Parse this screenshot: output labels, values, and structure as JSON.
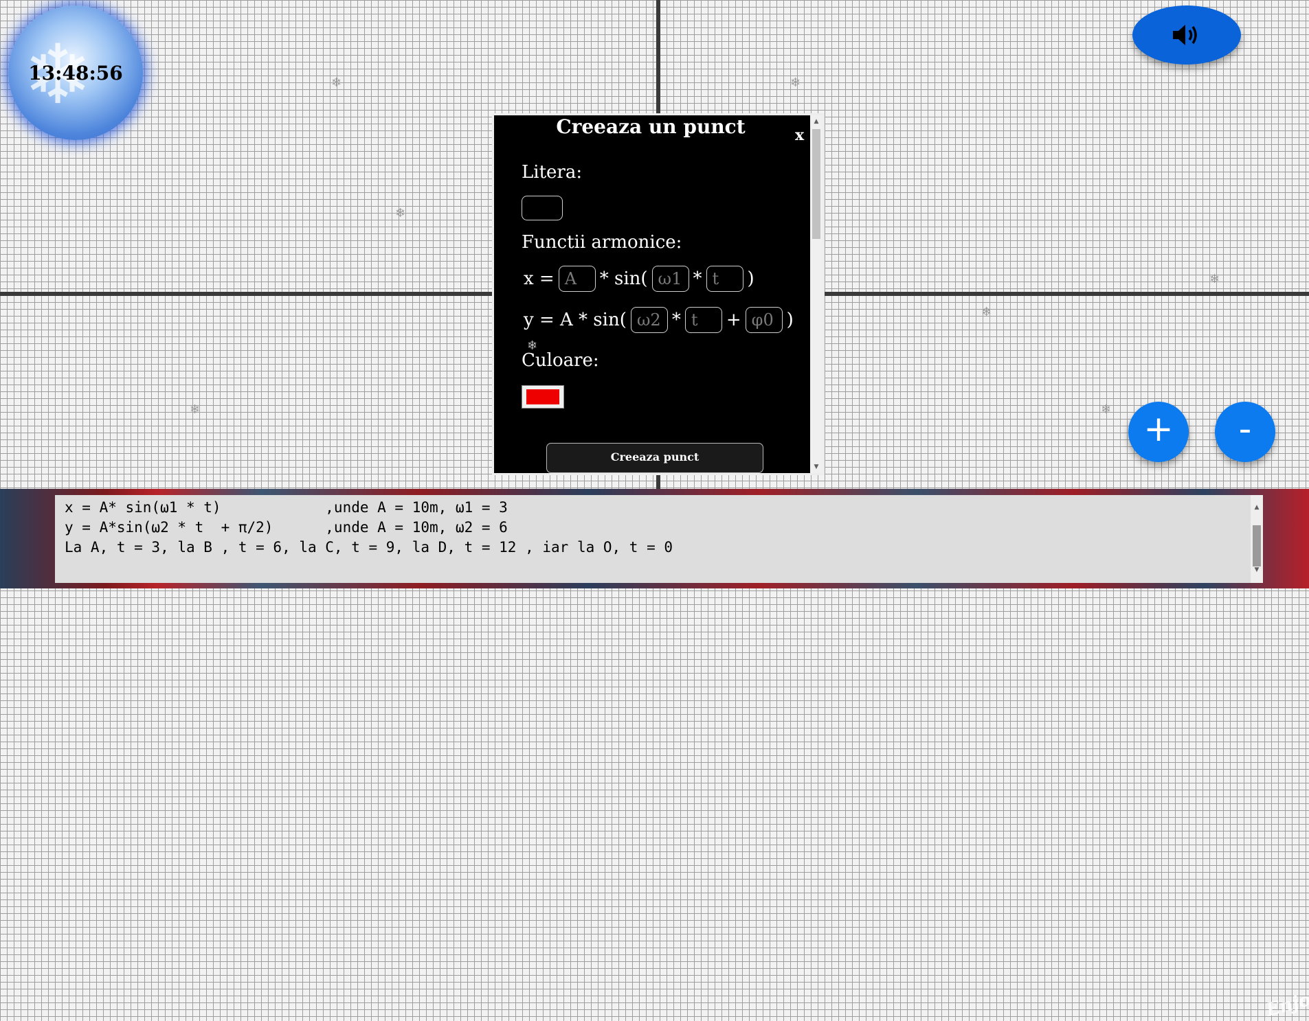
{
  "clock": {
    "time": "13:48:56"
  },
  "sound_button": {
    "icon": "speaker-icon"
  },
  "zoom": {
    "in_label": "+",
    "out_label": "-"
  },
  "modal": {
    "title": "Creeaza un punct",
    "close_label": "x",
    "letter_label": "Litera:",
    "harmonic_label": "Functii armonice:",
    "x_eq": {
      "prefix": "x =",
      "a_placeholder": "A",
      "mul1": "* sin(",
      "w1_placeholder": "ω1",
      "mul2": "*",
      "t_placeholder": "t",
      "close": ")"
    },
    "y_eq": {
      "prefix": "y = A * sin(",
      "w2_placeholder": "ω2",
      "mul": "*",
      "t_placeholder": "t",
      "plus": "+",
      "phi_placeholder": "φ0",
      "close": ")"
    },
    "color_label": "Culoare:",
    "color_value": "#ee0000",
    "submit_label": "Creeaza punct"
  },
  "notes": {
    "line1": "x = A* sin(ω1 * t)            ,unde A = 10m, ω1 = 3",
    "line2": "y = A*sin(ω2 * t  + π/2)      ,unde A = 10m, ω2 = 6",
    "line3": "La A, t = 3, la B , t = 6, la C, t = 9, la D, t = 12 , iar la O, t = 0"
  },
  "background": {
    "banner_text": "Enjoy"
  }
}
